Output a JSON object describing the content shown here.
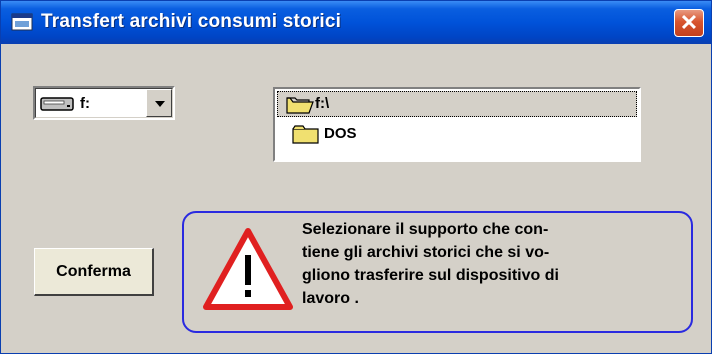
{
  "window": {
    "title": "Transfert archivi consumi storici",
    "close_symbol": "✕",
    "icons": {
      "title": "app-window-icon",
      "close": "close-icon"
    },
    "colors": {
      "titlebar": "#0052d9",
      "close": "#d8552e",
      "face": "#d4d0c8",
      "frame_border": "#2a2ae0",
      "warning": "#e02020"
    }
  },
  "drive_selector": {
    "value": "f:",
    "icon": "drive-icon",
    "dropdown_icon": "chevron-down-icon"
  },
  "directory_list": {
    "items": [
      {
        "label": "f:\\",
        "icon": "open-folder-icon"
      },
      {
        "label": "DOS",
        "icon": "folder-icon"
      }
    ]
  },
  "actions": {
    "confirm_label": "Conferma"
  },
  "message": {
    "icon": "warning-icon",
    "text": "Selezionare il supporto che con-\ntiene gli archivi storici che si vo-\ngliono trasferire sul dispositivo di\nlavoro ."
  }
}
